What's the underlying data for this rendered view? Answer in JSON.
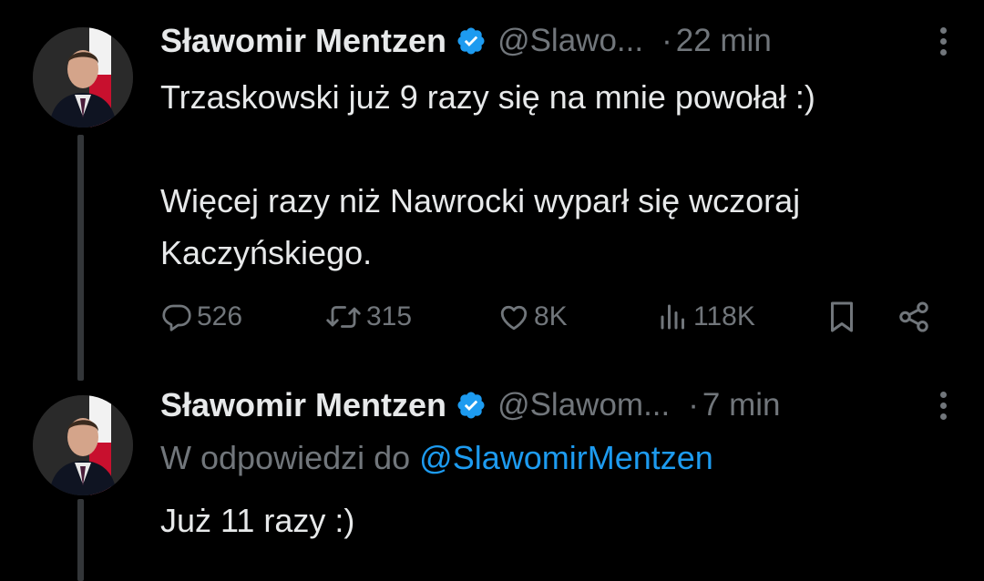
{
  "tweets": [
    {
      "name": "Sławomir Mentzen",
      "handle": "@Slawo...",
      "separator": "·",
      "time": "22 min",
      "lines": [
        "Trzaskowski już 9 razy się na mnie powołał :)",
        "",
        "Więcej razy niż Nawrocki wyparł się wczoraj",
        "Kaczyńskiego."
      ],
      "stats": {
        "replies": "526",
        "reposts": "315",
        "likes": "8K",
        "views": "118K"
      }
    },
    {
      "name": "Sławomir Mentzen",
      "handle": "@Slawom...",
      "separator": "·",
      "time": "7 min",
      "reply_prefix": "W odpowiedzi do",
      "reply_to": "@SlawomirMentzen",
      "lines": [
        "Już 11 razy :)"
      ]
    }
  ],
  "icons": {
    "verified": "verified-badge-icon",
    "more": "more-vertical-icon",
    "reply": "comment-icon",
    "repost": "repost-icon",
    "like": "heart-icon",
    "views": "views-bar-icon",
    "bookmark": "bookmark-icon",
    "share": "share-icon"
  },
  "colors": {
    "background": "#000000",
    "text": "#e7e9ea",
    "muted": "#71767b",
    "accent": "#1d9bf0"
  }
}
